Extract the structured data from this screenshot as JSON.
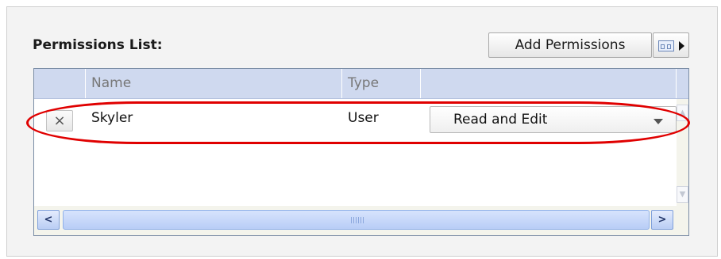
{
  "permissions": {
    "title": "Permissions List:",
    "add_button": "Add Permissions",
    "columns_button_icon": "columns-icon",
    "columns": {
      "name": "Name",
      "type": "Type",
      "permission": ""
    },
    "rows": [
      {
        "remove_icon": "×",
        "name": "Skyler",
        "type": "User",
        "permission": "Read and Edit"
      }
    ]
  },
  "scrollbar": {
    "left": "<",
    "right": ">"
  },
  "colors": {
    "header_bg": "#cfd9ef",
    "highlight": "#e00000"
  }
}
